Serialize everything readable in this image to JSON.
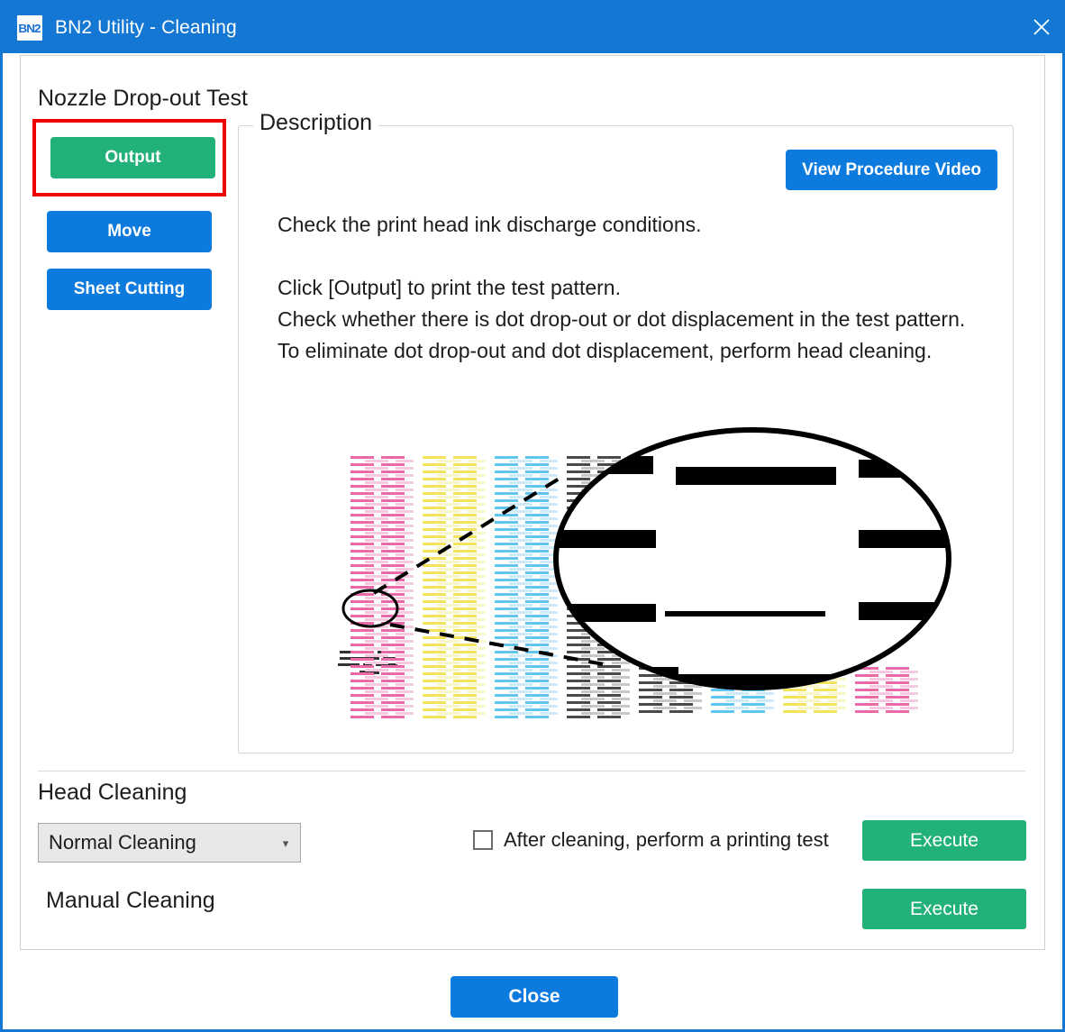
{
  "window": {
    "title": "BN2 Utility - Cleaning",
    "icon_name": "bn2-app-icon",
    "icon_glyph": "BN2",
    "close_icon": "close-icon",
    "accent_blue": "#1377d3",
    "accent_green": "#22b179",
    "highlight_red": "#ee0000"
  },
  "section": {
    "title": "Nozzle Drop-out Test"
  },
  "side_buttons": {
    "output": "Output",
    "move": "Move",
    "sheet_cutting": "Sheet Cutting"
  },
  "description": {
    "legend": "Description",
    "video_button": "View Procedure Video",
    "body": "Check the print head ink discharge conditions.\n\nClick [Output] to print the test pattern.\nCheck whether there is dot drop-out or dot displacement in the test pattern.\nTo eliminate dot drop-out and dot displacement, perform head cleaning.",
    "illustration_name": "nozzle-test-pattern-illustration"
  },
  "head_cleaning": {
    "title": "Head Cleaning",
    "select_value": "Normal Cleaning",
    "select_options": [
      "Normal Cleaning"
    ],
    "select_arrow_icon": "chevron-down-icon",
    "checkbox_label": "After cleaning, perform a printing test",
    "checkbox_checked": false,
    "execute": "Execute"
  },
  "manual_cleaning": {
    "title": "Manual Cleaning",
    "execute": "Execute"
  },
  "footer": {
    "close": "Close"
  }
}
